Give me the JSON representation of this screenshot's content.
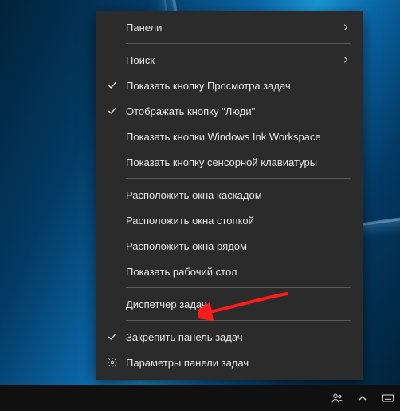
{
  "menu": {
    "items": [
      {
        "label": "Панели",
        "submenu": true,
        "checked": false,
        "icon": null
      },
      {
        "separator": true
      },
      {
        "label": "Поиск",
        "submenu": true,
        "checked": false,
        "icon": null
      },
      {
        "label": "Показать кнопку Просмотра задач",
        "submenu": false,
        "checked": true,
        "icon": null
      },
      {
        "label": "Отображать кнопку \"Люди\"",
        "submenu": false,
        "checked": true,
        "icon": null
      },
      {
        "label": "Показать кнопки Windows Ink Workspace",
        "submenu": false,
        "checked": false,
        "icon": null
      },
      {
        "label": "Показать кнопку сенсорной клавиатуры",
        "submenu": false,
        "checked": false,
        "icon": null
      },
      {
        "separator": true
      },
      {
        "label": "Расположить окна каскадом",
        "submenu": false,
        "checked": false,
        "icon": null
      },
      {
        "label": "Расположить окна стопкой",
        "submenu": false,
        "checked": false,
        "icon": null
      },
      {
        "label": "Расположить окна рядом",
        "submenu": false,
        "checked": false,
        "icon": null
      },
      {
        "label": "Показать рабочий стол",
        "submenu": false,
        "checked": false,
        "icon": null
      },
      {
        "separator": true
      },
      {
        "label": "Диспетчер задач",
        "submenu": false,
        "checked": false,
        "icon": null
      },
      {
        "separator": true
      },
      {
        "label": "Закрепить панель задач",
        "submenu": false,
        "checked": true,
        "icon": null
      },
      {
        "label": "Параметры панели задач",
        "submenu": false,
        "checked": false,
        "icon": "gear"
      }
    ]
  },
  "annotation": {
    "target_label": "Диспетчер задач"
  },
  "taskbar": {
    "tray": [
      "people-icon",
      "tray-chevron-icon",
      "keyboard-icon"
    ]
  }
}
